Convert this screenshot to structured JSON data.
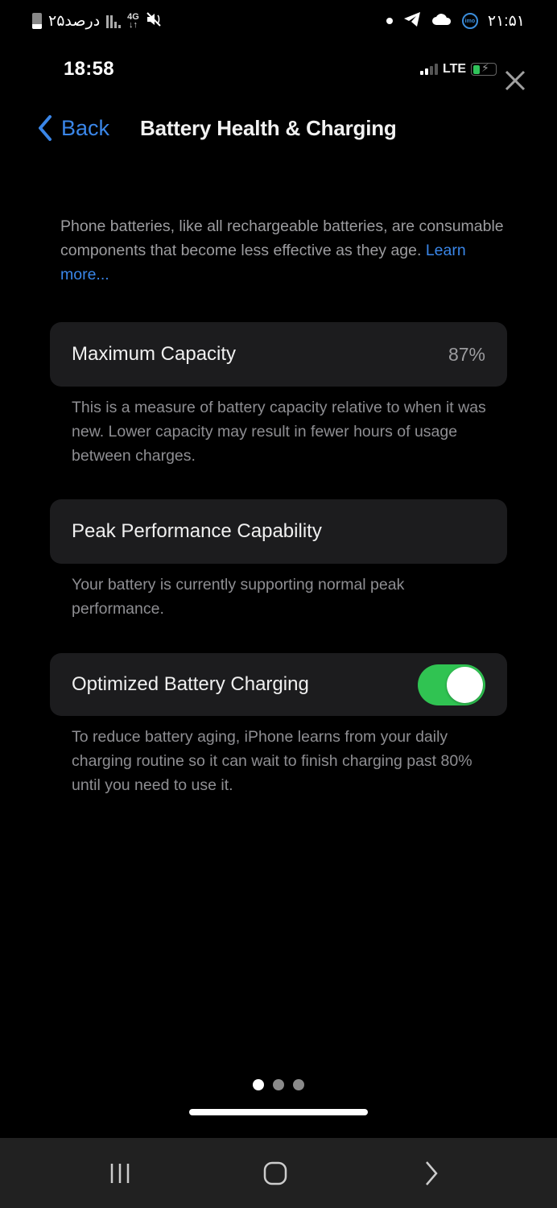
{
  "android_status_bar": {
    "battery_text": "۲۵درصد",
    "network_type": "4G",
    "clock": "۲۱:۵۱",
    "icons_left": [
      "battery-icon",
      "signal-icon",
      "4g-data-icon",
      "mute-icon"
    ],
    "icons_right": [
      "notification-dot-icon",
      "telegram-icon",
      "cloud-icon",
      "imo-icon"
    ],
    "imo_label": "imo"
  },
  "ios_status_bar": {
    "time": "18:58",
    "network": "LTE",
    "signal_bars_active": 2,
    "signal_bars_total": 4,
    "battery_charging": true
  },
  "nav": {
    "back_label": "Back",
    "title": "Battery Health & Charging"
  },
  "intro": {
    "text": "Phone batteries, like all rechargeable batteries, are consumable components that become less effective as they age. ",
    "link": "Learn more..."
  },
  "maximum_capacity": {
    "label": "Maximum Capacity",
    "value": "87%",
    "footnote": "This is a measure of battery capacity relative to when it was new. Lower capacity may result in fewer hours of usage between charges."
  },
  "peak_performance": {
    "label": "Peak Performance Capability",
    "footnote": "Your battery is currently supporting normal peak performance."
  },
  "optimized_charging": {
    "label": "Optimized Battery Charging",
    "enabled": true,
    "footnote": "To reduce battery aging, iPhone learns from your daily charging routine so it can wait to finish charging past 80% until you need to use it."
  },
  "pager": {
    "pages": 3,
    "current": 1
  },
  "colors": {
    "accent_blue": "#3a86e8",
    "toggle_green": "#30c352",
    "card_bg": "#1c1c1e",
    "secondary_text": "#9c9c9f"
  }
}
